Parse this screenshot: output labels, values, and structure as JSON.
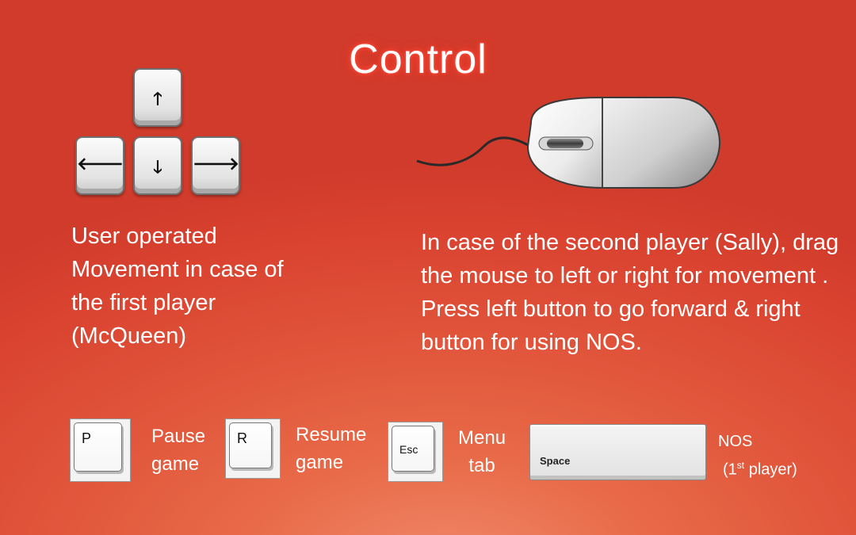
{
  "title": "Control",
  "arrow_keys": {
    "up": "🡑",
    "left": "🡐",
    "down": "🡓",
    "right": "🡒"
  },
  "left_description": "User operated Movement in case of the first player (McQueen)",
  "right_description": "In case of the second player (Sally), drag the mouse to left or right for movement . Press left button to go forward & right button for using NOS.",
  "mouse": {
    "icon": "mouse-icon"
  },
  "legend": [
    {
      "key": "P",
      "label_line1": "Pause",
      "label_line2": "game"
    },
    {
      "key": "R",
      "label_line1": "Resume",
      "label_line2": "game"
    },
    {
      "key": "Esc",
      "label_line1": "Menu",
      "label_line2": "tab"
    }
  ],
  "space_key": {
    "key": "Space",
    "label_line1": "NOS",
    "label_prefix": "(1",
    "label_sup": "st",
    "label_suffix": " player)"
  }
}
